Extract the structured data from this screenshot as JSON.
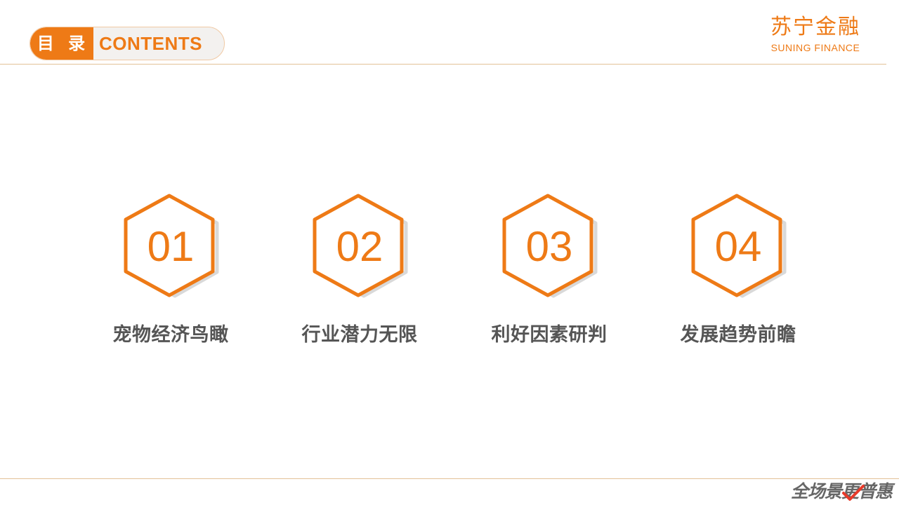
{
  "header": {
    "title_cn": "目 录",
    "title_en": "CONTENTS"
  },
  "logo": {
    "name_cn": "苏宁金融",
    "name_en": "SUNING FINANCE"
  },
  "items": [
    {
      "number": "01",
      "label": "宠物经济鸟瞰"
    },
    {
      "number": "02",
      "label": "行业潜力无限"
    },
    {
      "number": "03",
      "label": "利好因素研判"
    },
    {
      "number": "04",
      "label": "发展趋势前瞻"
    }
  ],
  "footer": {
    "slogan": "全场景更普惠"
  },
  "colors": {
    "accent": "#ee7a16",
    "text": "#555555",
    "line": "#e3c197",
    "hex_shadow": "#d9d9d9"
  }
}
